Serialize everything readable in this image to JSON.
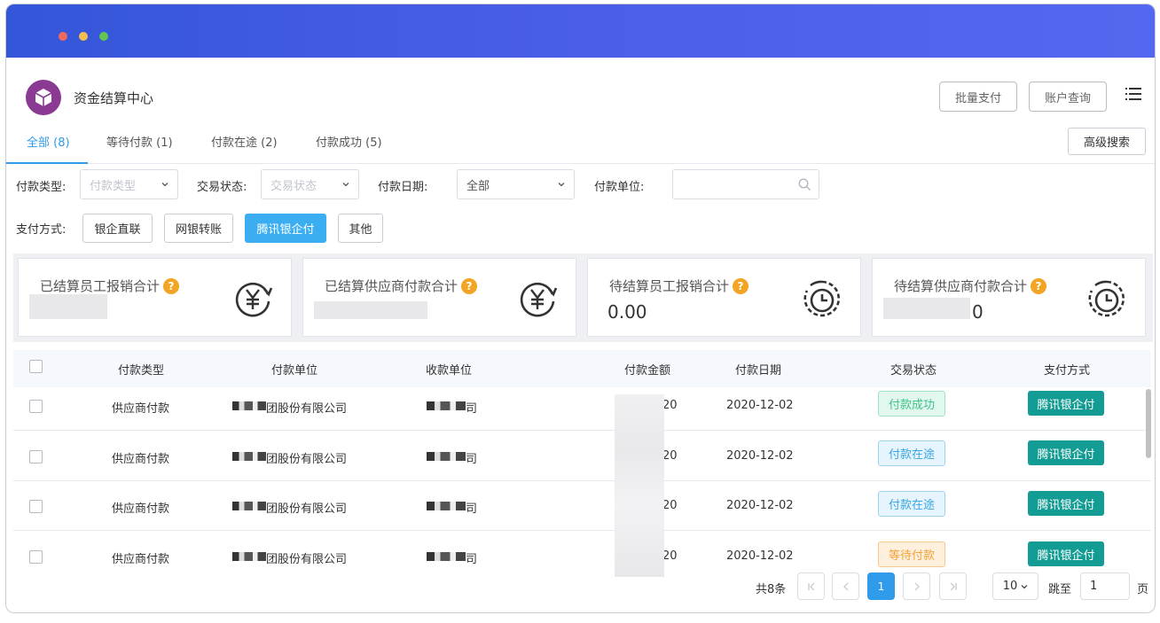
{
  "app": {
    "title": "资金结算中心"
  },
  "header": {
    "batch_pay": "批量支付",
    "account_query": "账户查询"
  },
  "tabs": [
    {
      "label": "全部 (8)"
    },
    {
      "label": "等待付款 (1)"
    },
    {
      "label": "付款在途 (2)"
    },
    {
      "label": "付款成功 (5)"
    }
  ],
  "advanced_search": "高级搜索",
  "filters": {
    "pay_type_label": "付款类型:",
    "pay_type_placeholder": "付款类型",
    "trade_status_label": "交易状态:",
    "trade_status_placeholder": "交易状态",
    "pay_date_label": "付款日期:",
    "pay_date_value": "全部",
    "payer_label": "付款单位:",
    "method_label": "支付方式:",
    "methods": [
      "银企直联",
      "网银转账",
      "腾讯银企付",
      "其他"
    ]
  },
  "cards": [
    {
      "title": "已结算员工报销合计",
      "value": ""
    },
    {
      "title": "已结算供应商付款合计",
      "value": ""
    },
    {
      "title": "待结算员工报销合计",
      "value": "0.00"
    },
    {
      "title": "待结算供应商付款合计",
      "value": "0"
    }
  ],
  "table": {
    "columns": [
      "付款类型",
      "付款单位",
      "收款单位",
      "付款金额",
      "付款日期",
      "交易状态",
      "支付方式"
    ],
    "rows": [
      {
        "type": "供应商付款",
        "payer": "团股份有限公司",
        "payee": "司",
        "amount": "20",
        "date": "2020-12-02",
        "status": "付款成功",
        "method": "腾讯银企付"
      },
      {
        "type": "供应商付款",
        "payer": "团股份有限公司",
        "payee": "司",
        "amount": "20",
        "date": "2020-12-02",
        "status": "付款在途",
        "method": "腾讯银企付"
      },
      {
        "type": "供应商付款",
        "payer": "团股份有限公司",
        "payee": "司",
        "amount": "20",
        "date": "2020-12-02",
        "status": "付款在途",
        "method": "腾讯银企付"
      },
      {
        "type": "供应商付款",
        "payer": "团股份有限公司",
        "payee": "司",
        "amount": "20",
        "date": "2020-12-02",
        "status": "等待付款",
        "method": "腾讯银企付"
      }
    ]
  },
  "pagination": {
    "total": "共8条",
    "current": "1",
    "page_size": "10",
    "jump_label": "跳至",
    "jump_value": "1",
    "page_suffix": "页"
  },
  "colors": {
    "accent": "#2f9bea",
    "pay_tag": "#129c93",
    "title_gradient_start": "#3456d8",
    "title_gradient_end": "#5468ef"
  }
}
